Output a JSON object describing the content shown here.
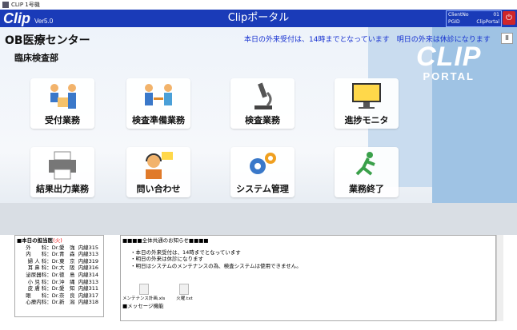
{
  "window": {
    "title": "CLIP 1号機"
  },
  "header": {
    "brand": "Clip",
    "version": "Ver5.0",
    "title": "Clipポータル",
    "client_label": "ClientNo",
    "client_value": "01",
    "pgid_label": "PGID",
    "pgid_value": "ClipPortal"
  },
  "main": {
    "hospital": "OB医療センター",
    "department": "臨床検査部",
    "notice": "本日の外来受付は、14時までとなっています　明日の外来は休診になります",
    "pause_label": "II",
    "logo_line1": "CLIP",
    "logo_line2": "PORTAL",
    "tiles": [
      {
        "label": "受付業務",
        "icon": "reception-icon"
      },
      {
        "label": "検査準備業務",
        "icon": "prep-icon"
      },
      {
        "label": "検査業務",
        "icon": "microscope-icon"
      },
      {
        "label": "進捗モニタ",
        "icon": "monitor-icon"
      },
      {
        "label": "結果出力業務",
        "icon": "printer-icon"
      },
      {
        "label": "問い合わせ",
        "icon": "headset-icon"
      },
      {
        "label": "システム管理",
        "icon": "gears-icon"
      },
      {
        "label": "業務終了",
        "icon": "exit-icon"
      }
    ]
  },
  "doctors": {
    "title": "■本日の担当医",
    "title_note": "(火)",
    "rows": [
      [
        "外　　科",
        "：Dr.愛　強",
        "内線315"
      ],
      [
        "内　　科",
        "：Dr.青　森",
        "内線313"
      ],
      [
        "婦 人 科",
        "：Dr.東　京",
        "内線319"
      ],
      [
        "耳 鼻 科",
        "：Dr.大　阪",
        "内線316"
      ],
      [
        "泌尿器科",
        "：Dr.徳　島",
        "内線314"
      ],
      [
        "小 児 科",
        "：Dr.沖　縄",
        "内線313"
      ],
      [
        "皮 膚 科",
        "：Dr.愛　知",
        "内線311"
      ],
      [
        "眼　　科",
        "：Dr.奈　良",
        "内線317"
      ],
      [
        "心療内科",
        "：Dr.新　潟",
        "内線318"
      ]
    ]
  },
  "notices": {
    "header": "■■■■全体共通のお知らせ■■■■",
    "lines": [
      "・本日の外来受付は、14時までとなっています",
      "・明日の外来は休診になります",
      "・明日はシステムのメンテナンスの為、検査システムは使用できません。"
    ],
    "files": [
      "メンテナンス計画.xls",
      "火曜.txt"
    ],
    "msg_header": "■メッセージ機能"
  }
}
